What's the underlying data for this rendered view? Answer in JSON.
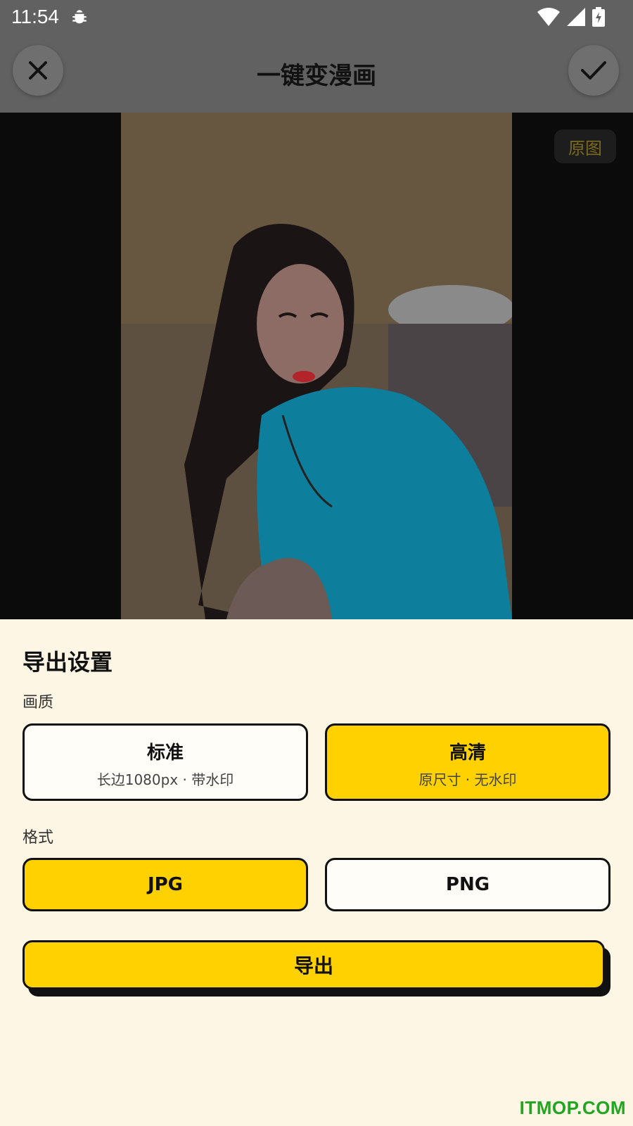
{
  "status_bar": {
    "time": "11:54"
  },
  "header": {
    "title": "一键变漫画"
  },
  "preview": {
    "original_label": "原图"
  },
  "export_sheet": {
    "title": "导出设置",
    "quality_label": "画质",
    "quality_options": [
      {
        "title": "标准",
        "subtitle": "长边1080px · 带水印",
        "selected": false
      },
      {
        "title": "高清",
        "subtitle": "原尺寸 · 无水印",
        "selected": true
      }
    ],
    "format_label": "格式",
    "format_options": [
      {
        "title": "JPG",
        "selected": true
      },
      {
        "title": "PNG",
        "selected": false
      }
    ],
    "export_button": "导出"
  },
  "watermark": "ITMOP.COM",
  "colors": {
    "accent": "#ffd100",
    "sheet_bg": "#fdf6e4",
    "header_bg": "#616161"
  }
}
